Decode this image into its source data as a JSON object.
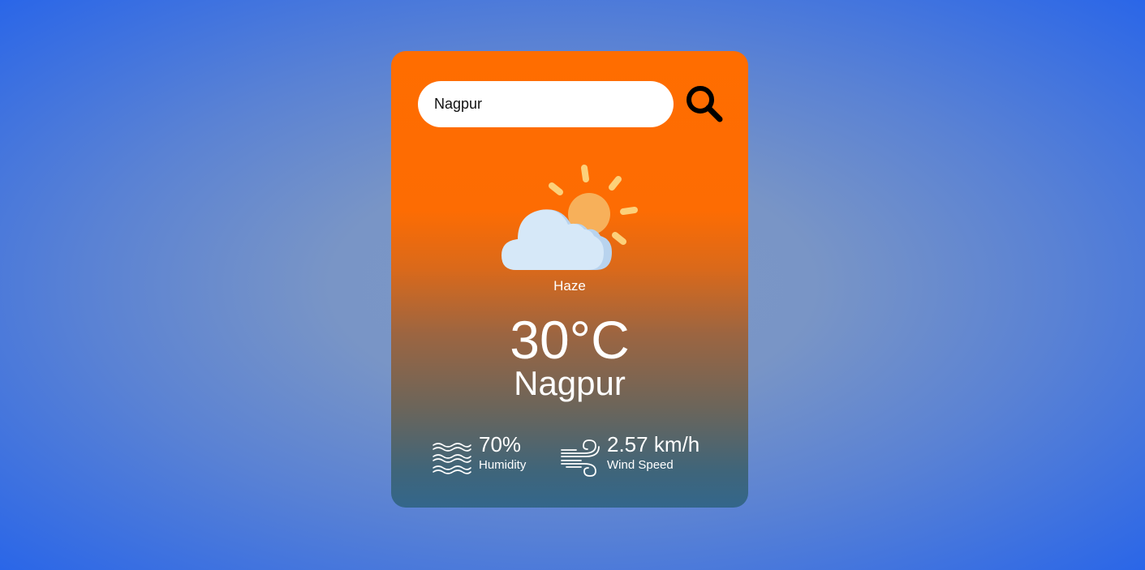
{
  "search": {
    "value": "Nagpur",
    "icon": "search-icon"
  },
  "weather": {
    "icon": "cloud-sun-icon",
    "condition": "Haze",
    "temperature": "30°C",
    "city": "Nagpur"
  },
  "stats": {
    "humidity": {
      "icon": "humidity-waves-icon",
      "value": "70%",
      "label": "Humidity"
    },
    "wind": {
      "icon": "wind-icon",
      "value": "2.57 km/h",
      "label": "Wind Speed"
    }
  },
  "colors": {
    "card_top": "#ff6d00",
    "card_bottom": "#33668b",
    "background_center": "#7b97c6",
    "background_edge": "#2a66e8",
    "sun": "#f7b05a",
    "sun_rays": "#fcd07a",
    "cloud": "#d6e8f8"
  }
}
